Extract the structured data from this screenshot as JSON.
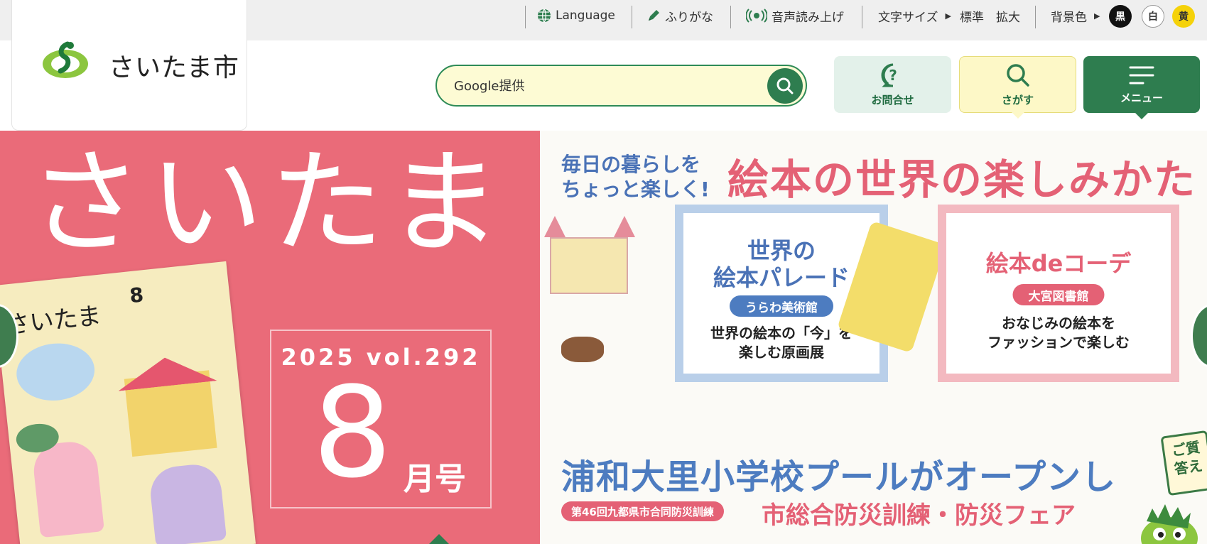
{
  "utility_bar": {
    "language": "Language",
    "furigana": "ふりがな",
    "read_aloud": "音声読み上げ",
    "font_size": {
      "label": "文字サイズ",
      "standard": "標準",
      "large": "拡大"
    },
    "background": {
      "label": "背景色",
      "black": "黒",
      "white": "白",
      "yellow": "黄"
    }
  },
  "header": {
    "logo_text": "さいたま市",
    "search": {
      "placeholder": "Google提供"
    },
    "buttons": {
      "contact": "お問合せ",
      "search": "さがす",
      "menu": "メニュー"
    }
  },
  "hero": {
    "left": {
      "big_title": "さいたま",
      "issue_year_vol": "2025 vol.292",
      "issue_month": "8",
      "issue_unit": "月号",
      "magazine_title": "さいたま",
      "magazine_month": "8"
    },
    "right": {
      "tagline_1": "毎日の暮らしを",
      "tagline_2": "ちょっと楽しく!",
      "feature_title": "絵本の世界の楽しみかた",
      "panel1": {
        "title_1": "世界の",
        "title_2": "絵本パレード",
        "venue": "うらわ美術館",
        "desc_1": "世界の絵本の「今」を",
        "desc_2": "楽しむ原画展"
      },
      "panel2": {
        "title": "絵本deコーデ",
        "venue": "大宮図書館",
        "desc_1": "おなじみの絵本を",
        "desc_2": "ファッションで楽しむ"
      },
      "headline2": "浦和大里小学校プールがオープンし",
      "event_pill": "第46回九都県市合同防災訓練",
      "event_title": "市総合防災訓練・防災フェア",
      "qa_sign_1": "ご質",
      "qa_sign_2": "答え"
    }
  },
  "colors": {
    "brand_green": "#2e7d4f",
    "hero_pink": "#ea6b79",
    "search_bg": "#fdfbd4",
    "contact_bg": "#e3f1ea",
    "search_btn_bg": "#fdf8c7",
    "accent_blue": "#4d7cc0",
    "accent_pink": "#e46175"
  },
  "icons": [
    "globe-icon",
    "pencil-icon",
    "speaker-icon",
    "search-icon",
    "question-bubble-icon",
    "hamburger-icon"
  ]
}
